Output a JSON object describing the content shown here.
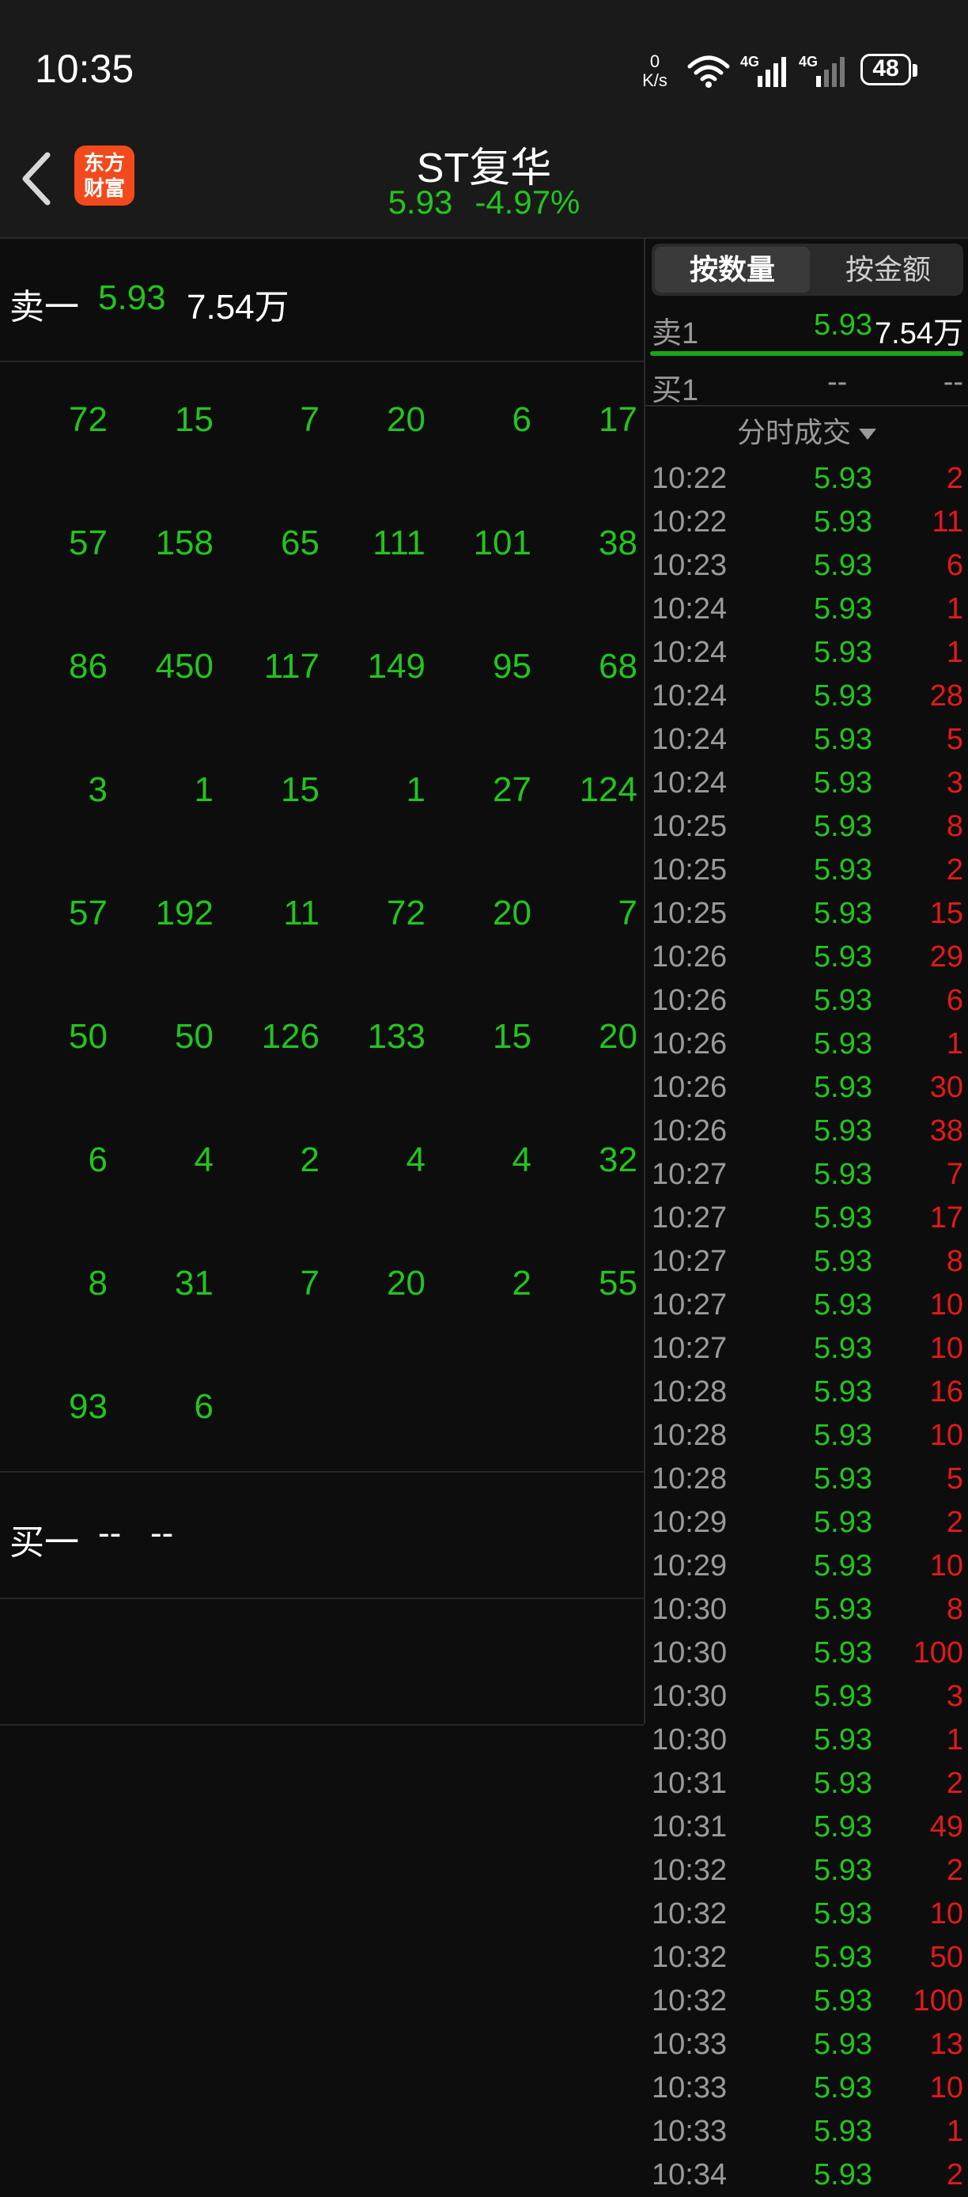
{
  "status_bar": {
    "time": "10:35",
    "net_speed_value": "0",
    "net_speed_unit": "K/s",
    "signal1_label": "4G",
    "signal2_label": "4G",
    "battery": "48"
  },
  "header": {
    "logo_text_line1": "东方",
    "logo_text_line2": "财富",
    "stock_name": "ST复华",
    "price": "5.93",
    "change_pct": "-4.97%"
  },
  "left": {
    "ask": {
      "label": "卖一",
      "price": "5.93",
      "volume": "7.54万"
    },
    "queue": [
      [
        "72",
        "15",
        "7",
        "20",
        "6",
        "17"
      ],
      [
        "57",
        "158",
        "65",
        "111",
        "101",
        "38"
      ],
      [
        "86",
        "450",
        "117",
        "149",
        "95",
        "68"
      ],
      [
        "3",
        "1",
        "15",
        "1",
        "27",
        "124"
      ],
      [
        "57",
        "192",
        "11",
        "72",
        "20",
        "7"
      ],
      [
        "50",
        "50",
        "126",
        "133",
        "15",
        "20"
      ],
      [
        "6",
        "4",
        "2",
        "4",
        "4",
        "32"
      ],
      [
        "8",
        "31",
        "7",
        "20",
        "2",
        "55"
      ],
      [
        "93",
        "6"
      ]
    ],
    "bid": {
      "label": "买一",
      "price": "--",
      "volume": "--"
    }
  },
  "right": {
    "toggle": {
      "by_quantity": "按数量",
      "by_amount": "按金额"
    },
    "sell1": {
      "label": "卖1",
      "price": "5.93",
      "volume": "7.54万"
    },
    "buy1": {
      "label": "买1",
      "price": "--",
      "volume": "--"
    },
    "ticks_title": "分时成交",
    "ticks": [
      {
        "time": "10:22",
        "price": "5.93",
        "vol": "2"
      },
      {
        "time": "10:22",
        "price": "5.93",
        "vol": "11"
      },
      {
        "time": "10:23",
        "price": "5.93",
        "vol": "6"
      },
      {
        "time": "10:24",
        "price": "5.93",
        "vol": "1"
      },
      {
        "time": "10:24",
        "price": "5.93",
        "vol": "1"
      },
      {
        "time": "10:24",
        "price": "5.93",
        "vol": "28"
      },
      {
        "time": "10:24",
        "price": "5.93",
        "vol": "5"
      },
      {
        "time": "10:24",
        "price": "5.93",
        "vol": "3"
      },
      {
        "time": "10:25",
        "price": "5.93",
        "vol": "8"
      },
      {
        "time": "10:25",
        "price": "5.93",
        "vol": "2"
      },
      {
        "time": "10:25",
        "price": "5.93",
        "vol": "15"
      },
      {
        "time": "10:26",
        "price": "5.93",
        "vol": "29"
      },
      {
        "time": "10:26",
        "price": "5.93",
        "vol": "6"
      },
      {
        "time": "10:26",
        "price": "5.93",
        "vol": "1"
      },
      {
        "time": "10:26",
        "price": "5.93",
        "vol": "30"
      },
      {
        "time": "10:26",
        "price": "5.93",
        "vol": "38"
      },
      {
        "time": "10:27",
        "price": "5.93",
        "vol": "7"
      },
      {
        "time": "10:27",
        "price": "5.93",
        "vol": "17"
      },
      {
        "time": "10:27",
        "price": "5.93",
        "vol": "8"
      },
      {
        "time": "10:27",
        "price": "5.93",
        "vol": "10"
      },
      {
        "time": "10:27",
        "price": "5.93",
        "vol": "10"
      },
      {
        "time": "10:28",
        "price": "5.93",
        "vol": "16"
      },
      {
        "time": "10:28",
        "price": "5.93",
        "vol": "10"
      },
      {
        "time": "10:28",
        "price": "5.93",
        "vol": "5"
      },
      {
        "time": "10:29",
        "price": "5.93",
        "vol": "2"
      },
      {
        "time": "10:29",
        "price": "5.93",
        "vol": "10"
      },
      {
        "time": "10:30",
        "price": "5.93",
        "vol": "8"
      },
      {
        "time": "10:30",
        "price": "5.93",
        "vol": "100"
      },
      {
        "time": "10:30",
        "price": "5.93",
        "vol": "3"
      },
      {
        "time": "10:30",
        "price": "5.93",
        "vol": "1"
      },
      {
        "time": "10:31",
        "price": "5.93",
        "vol": "2"
      },
      {
        "time": "10:31",
        "price": "5.93",
        "vol": "49"
      },
      {
        "time": "10:32",
        "price": "5.93",
        "vol": "2"
      },
      {
        "time": "10:32",
        "price": "5.93",
        "vol": "10"
      },
      {
        "time": "10:32",
        "price": "5.93",
        "vol": "50"
      },
      {
        "time": "10:32",
        "price": "5.93",
        "vol": "100"
      },
      {
        "time": "10:33",
        "price": "5.93",
        "vol": "13"
      },
      {
        "time": "10:33",
        "price": "5.93",
        "vol": "10"
      },
      {
        "time": "10:33",
        "price": "5.93",
        "vol": "1"
      },
      {
        "time": "10:34",
        "price": "5.93",
        "vol": "2"
      }
    ]
  },
  "colors": {
    "up_green": "#23c41f",
    "down_red": "#e3191b",
    "background": "#0d0d0d",
    "header": "#1a1a1a",
    "logo": "#f24a1c"
  }
}
